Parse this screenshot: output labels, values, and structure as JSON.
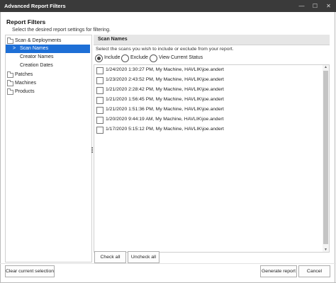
{
  "window": {
    "title": "Advanced Report Filters",
    "minimize_glyph": "—",
    "maximize_glyph": "☐",
    "close_glyph": "✕"
  },
  "header": {
    "title": "Report Filters",
    "subtitle": "Select the desired report settings for filtering."
  },
  "tree": {
    "items": [
      {
        "label": "Scan & Deployments",
        "icon": "folder-icon"
      },
      {
        "label": "Scan Names",
        "selected": true
      },
      {
        "label": "Creator Names"
      },
      {
        "label": "Creation Dates"
      },
      {
        "label": "Patches",
        "icon": "folder-icon"
      },
      {
        "label": "Machines",
        "icon": "folder-icon"
      },
      {
        "label": "Products",
        "icon": "folder-icon"
      }
    ]
  },
  "panel": {
    "header": "Scan Names",
    "description": "Select the scans you wish to include or exclude from your report.",
    "radios": [
      {
        "label": "Include",
        "checked": true
      },
      {
        "label": "Exclude",
        "checked": false
      },
      {
        "label": "View Current Status",
        "checked": false
      }
    ],
    "scans": [
      "1/24/2020 1:30:27 PM, My Machine, HAVLIK\\joe.andert",
      "1/23/2020 2:43:52 PM, My Machine, HAVLIK\\joe.andert",
      "1/21/2020 2:28:42 PM, My Machine, HAVLIK\\joe.andert",
      "1/21/2020 1:56:45 PM, My Machine, HAVLIK\\joe.andert",
      "1/21/2020 1:51:36 PM, My Machine, HAVLIK\\joe.andert",
      "1/20/2020 9:44:19 AM, My Machine, HAVLIK\\joe.andert",
      "1/17/2020 5:15:12 PM, My Machine, HAVLIK\\joe.andert"
    ],
    "check_all": "Check all",
    "uncheck_all": "Uncheck all"
  },
  "footer": {
    "clear": "Clear current selection",
    "generate": "Generate report",
    "cancel": "Cancel"
  }
}
